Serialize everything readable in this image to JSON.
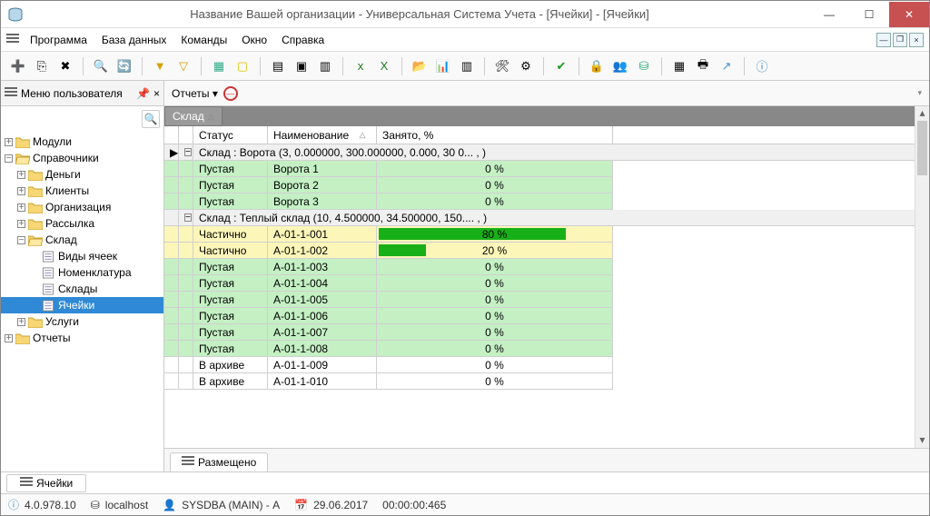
{
  "title": "Название Вашей организации - Универсальная Система Учета - [Ячейки] - [Ячейки]",
  "menu": {
    "items": [
      "Программа",
      "База данных",
      "Команды",
      "Окно",
      "Справка"
    ]
  },
  "left": {
    "header": "Меню пользователя",
    "tree": [
      {
        "lvl": 1,
        "pm": "+",
        "icon": "folder",
        "label": "Модули"
      },
      {
        "lvl": 1,
        "pm": "−",
        "icon": "folder-open",
        "label": "Справочники"
      },
      {
        "lvl": 2,
        "pm": "+",
        "icon": "folder",
        "label": "Деньги"
      },
      {
        "lvl": 2,
        "pm": "+",
        "icon": "folder",
        "label": "Клиенты"
      },
      {
        "lvl": 2,
        "pm": "+",
        "icon": "folder",
        "label": "Организация"
      },
      {
        "lvl": 2,
        "pm": "+",
        "icon": "folder",
        "label": "Рассылка"
      },
      {
        "lvl": 2,
        "pm": "−",
        "icon": "folder-open",
        "label": "Склад"
      },
      {
        "lvl": 3,
        "pm": "",
        "icon": "doc",
        "label": "Виды ячеек"
      },
      {
        "lvl": 3,
        "pm": "",
        "icon": "doc",
        "label": "Номенклатура"
      },
      {
        "lvl": 3,
        "pm": "",
        "icon": "doc",
        "label": "Склады"
      },
      {
        "lvl": 3,
        "pm": "",
        "icon": "doc",
        "label": "Ячейки",
        "sel": true
      },
      {
        "lvl": 2,
        "pm": "+",
        "icon": "folder",
        "label": "Услуги"
      },
      {
        "lvl": 1,
        "pm": "+",
        "icon": "folder",
        "label": "Отчеты"
      }
    ]
  },
  "reports_label": "Отчеты",
  "group_field": "Склад",
  "columns": {
    "status": "Статус",
    "name": "Наименование",
    "pct": "Занято, %"
  },
  "groups": [
    {
      "title": "Склад : Ворота (3, 0.000000, 300.000000, 0.000, 30 0... , )",
      "pm": "−",
      "rows": [
        {
          "status": "Пустая",
          "name": "Ворота 1",
          "pct": 0,
          "cls": "green"
        },
        {
          "status": "Пустая",
          "name": "Ворота 2",
          "pct": 0,
          "cls": "green"
        },
        {
          "status": "Пустая",
          "name": "Ворота 3",
          "pct": 0,
          "cls": "green"
        }
      ]
    },
    {
      "title": "Склад : Теплый склад (10, 4.500000, 34.500000, 150.... , )",
      "pm": "−",
      "rows": [
        {
          "status": "Частично",
          "name": "A-01-1-001",
          "pct": 80,
          "cls": "yellow"
        },
        {
          "status": "Частично",
          "name": "A-01-1-002",
          "pct": 20,
          "cls": "yellow"
        },
        {
          "status": "Пустая",
          "name": "A-01-1-003",
          "pct": 0,
          "cls": "green"
        },
        {
          "status": "Пустая",
          "name": "A-01-1-004",
          "pct": 0,
          "cls": "green"
        },
        {
          "status": "Пустая",
          "name": "A-01-1-005",
          "pct": 0,
          "cls": "green"
        },
        {
          "status": "Пустая",
          "name": "A-01-1-006",
          "pct": 0,
          "cls": "green"
        },
        {
          "status": "Пустая",
          "name": "A-01-1-007",
          "pct": 0,
          "cls": "green"
        },
        {
          "status": "Пустая",
          "name": "A-01-1-008",
          "pct": 0,
          "cls": "green"
        },
        {
          "status": "В архиве",
          "name": "A-01-1-009",
          "pct": 0,
          "cls": "white"
        },
        {
          "status": "В архиве",
          "name": "A-01-1-010",
          "pct": 0,
          "cls": "white"
        }
      ]
    }
  ],
  "bottom_tab": "Размещено",
  "doc_tab": "Ячейки",
  "status": {
    "version": "4.0.978.10",
    "host": "localhost",
    "user": "SYSDBA (MAIN) - А",
    "date": "29.06.2017",
    "time": "00:00:00:465"
  }
}
